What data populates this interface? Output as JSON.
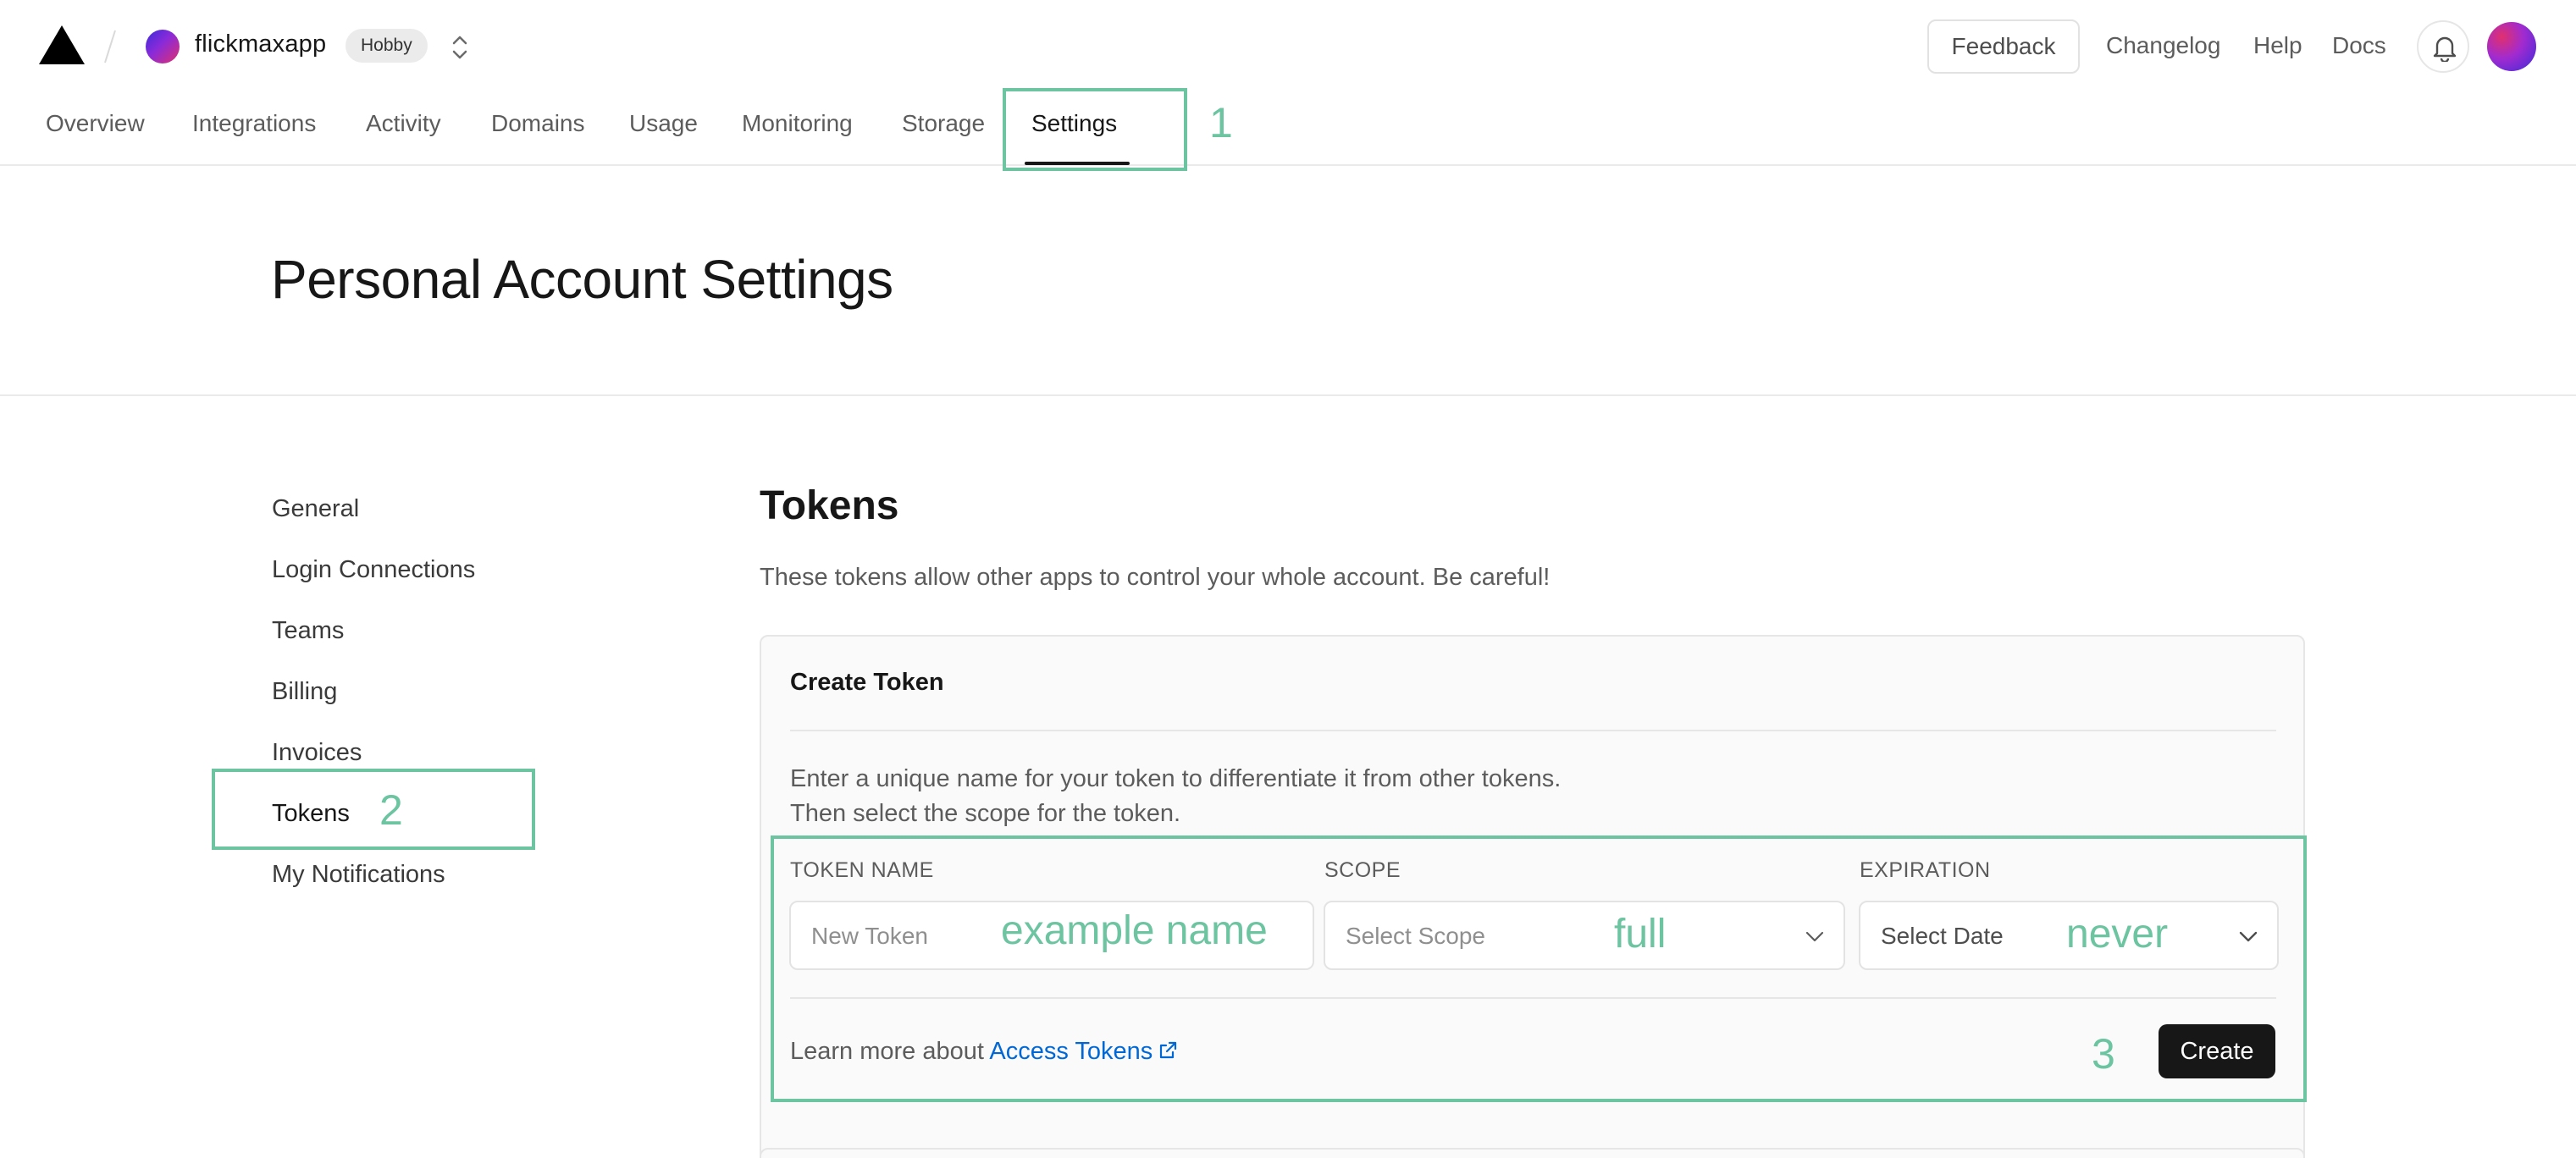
{
  "header": {
    "project_name": "flickmaxapp",
    "plan_badge": "Hobby",
    "links": {
      "feedback": "Feedback",
      "changelog": "Changelog",
      "help": "Help",
      "docs": "Docs"
    }
  },
  "nav": {
    "tabs": [
      {
        "label": "Overview"
      },
      {
        "label": "Integrations"
      },
      {
        "label": "Activity"
      },
      {
        "label": "Domains"
      },
      {
        "label": "Usage"
      },
      {
        "label": "Monitoring"
      },
      {
        "label": "Storage"
      },
      {
        "label": "Settings",
        "active": true
      }
    ]
  },
  "page": {
    "title": "Personal Account Settings"
  },
  "sidebar": {
    "items": [
      {
        "label": "General"
      },
      {
        "label": "Login Connections"
      },
      {
        "label": "Teams"
      },
      {
        "label": "Billing"
      },
      {
        "label": "Invoices"
      },
      {
        "label": "Tokens",
        "active": true
      },
      {
        "label": "My Notifications"
      }
    ]
  },
  "tokens": {
    "title": "Tokens",
    "description": "These tokens allow other apps to control your whole account. Be careful!",
    "create_card": {
      "title": "Create Token",
      "description_line1": "Enter a unique name for your token to differentiate it from other tokens.",
      "description_line2": "Then select the scope for the token.",
      "fields": {
        "token_name": {
          "label": "TOKEN NAME",
          "placeholder": "New Token"
        },
        "scope": {
          "label": "SCOPE",
          "value": "Select Scope"
        },
        "expiration": {
          "label": "EXPIRATION",
          "value": "Select Date"
        }
      },
      "learn_more_prefix": "Learn more about",
      "learn_more_link": "Access Tokens",
      "create_button": "Create"
    }
  },
  "annotations": {
    "step1": "1",
    "step2": "2",
    "step3": "3",
    "token_name_example": "example name",
    "scope_example": "full",
    "expiration_example": "never",
    "color": "#6cc4a1"
  },
  "icons": [
    "vercel-logo-icon",
    "chevron-updown-icon",
    "bell-icon",
    "chevron-down-icon",
    "external-link-icon"
  ]
}
